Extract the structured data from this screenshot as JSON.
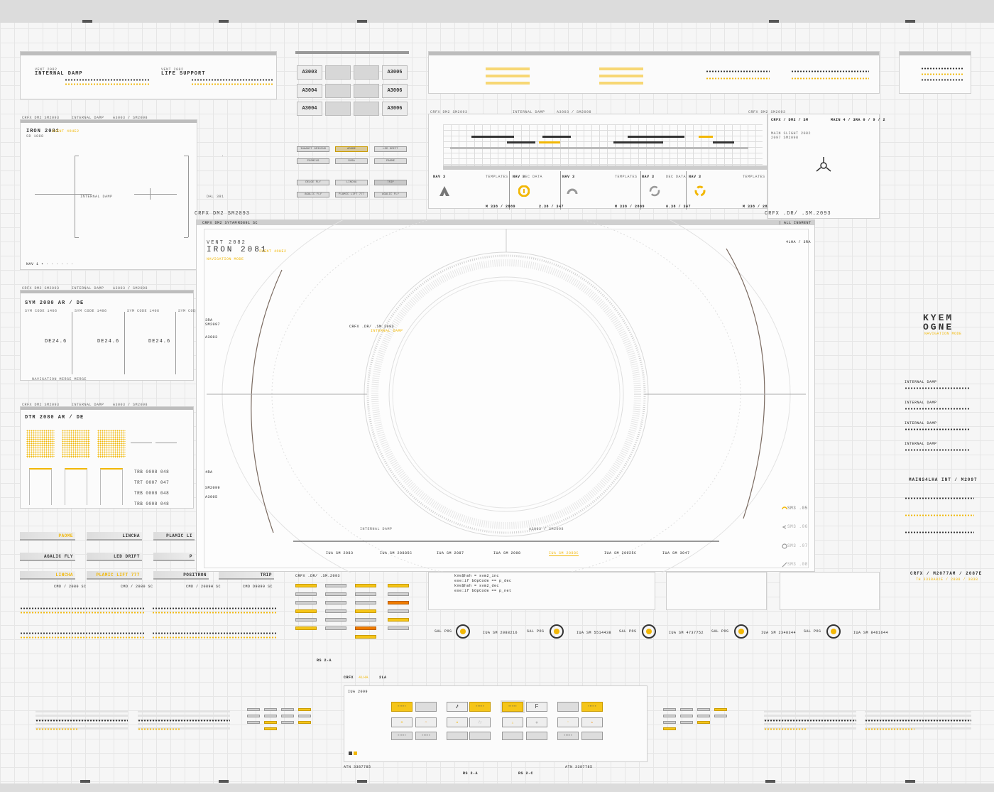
{
  "colors": {
    "accent": "#f2b705",
    "warn": "#f08a00",
    "ink": "#333333"
  },
  "top_panel": {
    "left_title_a_small": "VENT 2082",
    "left_title_a": "INTERNAL DAMP",
    "left_title_b_small": "VENT 2082",
    "left_title_b": "LIFE SUPPORT"
  },
  "tiles": [
    "A3003",
    "A3005",
    "A3004",
    "A3006",
    "A3004",
    "A3006"
  ],
  "tile_buttons": [
    "INHABIT ORIGINS",
    "ADOBE",
    "LED DRIFT",
    "POSMIUS",
    "SUSA",
    "PAOME",
    "DELGE FLY",
    "LINCHA",
    "TRIP",
    "AGALIC FLY",
    "PLAMIC LIFT 777",
    "AGALIC FLY"
  ],
  "left_iron_panel": {
    "header_a": "CRFX DM2 SM2093",
    "header_b": "INTERNAL DAMP",
    "header_c": "A3003 / SM2098",
    "title": "IRON 2081",
    "title_tag": "2VENT 4OHE2",
    "sub": "SD 1088",
    "label_mid": "INTERNAL DAMP",
    "label_right": "DAL 391"
  },
  "sym_panel": {
    "header_a": "CRFX DM2 SM2093",
    "header_b": "INTERNAL DAMP",
    "header_c": "A3003 / SM2098",
    "title": "SYM 2080 AR / DE",
    "cols": [
      "SYM CODE 1406",
      "SYM CODE 1406",
      "SYM CODE 1406",
      "SYM CODE 1406"
    ],
    "values": [
      "DE24.6",
      "DE24.6",
      "DE24.6"
    ],
    "foot": "NAVIGATION   MERGE   MERGE"
  },
  "dtr_panel": {
    "header_a": "CRFX DM2 SM2093",
    "header_b": "INTERNAL DAMP",
    "header_c": "A3003 / SM2098",
    "title": "DTR 2080 AR / DE",
    "rows": [
      "TRB  0008  048",
      "TRT  0007  047",
      "TRB  0008  048",
      "TRB  0008  048"
    ]
  },
  "side_buttons": [
    {
      "label": "PAOME",
      "accent": true
    },
    {
      "label": "LINCHA",
      "accent": false
    },
    {
      "label": "PLAMIC LI",
      "accent": false
    },
    {
      "label": "AGALIC FLY",
      "accent": false
    },
    {
      "label": "LED DRIFT",
      "accent": false
    },
    {
      "label": "P",
      "accent": false
    },
    {
      "label": "LINCHA",
      "accent": true
    },
    {
      "label": "PLAMIC LIFT 777",
      "accent": true
    },
    {
      "label": "POSITRON",
      "accent": false
    },
    {
      "label": "TRIP",
      "accent": false
    }
  ],
  "side_codes": [
    "CMD / 2080 SC",
    "CMD / 2080 SC",
    "CMD / 2089H SC",
    "CMD D9899 SC"
  ],
  "main": {
    "top_left_header": "CRFX DM2 SM2093",
    "top_right_header": "CRFX .DR/ .SM.2093",
    "sub_left": "CRFX DM2 SYTAM",
    "sub_left2": "RD891 SC",
    "alignment": "| ALL INGMENT",
    "vent": "VENT 2082",
    "iron": "IRON 2081",
    "iron_tag": "2VENT 4OHE2",
    "nav_status": "NAVIGATION MODE",
    "corner_tr": "4LHA / 3RA",
    "left_a": "3RA",
    "left_b": "SM2097",
    "left_c": "A3003",
    "left_d": "4RA",
    "left_e": "SM2099",
    "left_f": "A3005",
    "ring_label": "CRFX .DR/ .SM.2093",
    "ring_sub": "INTERNAL DAMP",
    "bottom_left": "INTERNAL DAMP",
    "bottom_right": "A3003 / SM2098",
    "scale_labels": [
      "IUA SM 2083",
      "IUA SM 20885C",
      "IUA SM 2087",
      "IUA SM 2098",
      "IUA SM 2088C",
      "IUA SM 20925C",
      "IUA SM 3047"
    ],
    "sm_labels": [
      "SM3 .05",
      "SM3 .06",
      "SM3 .07",
      "SM3 .08"
    ]
  },
  "schedule_panel": {
    "header_a": "CRFX DM2 SM2093",
    "header_b": "INTERNAL DAMP",
    "header_c": "A3003 / SM2098",
    "header_d": "CRFX DM2 SM2093",
    "cards": [
      {
        "tag": "NAV 3",
        "mode": "TEMPLATES",
        "value": "M 338 / 2889"
      },
      {
        "tag": "NAV 3",
        "mode": "DEC DATA",
        "value": "2.38 / 347"
      },
      {
        "tag": "NAV 3",
        "mode": "TEMPLATES",
        "value": "M 338 / 2889"
      },
      {
        "tag": "NAV 3",
        "mode": "DEC DATA",
        "value": "0.38 / 347"
      },
      {
        "tag": "NAV 3",
        "mode": "TEMPLATES",
        "value": "M 338 / 2889"
      }
    ]
  },
  "right_panel": {
    "title": "CRFX / DM2 / SM",
    "sub": "MAIN 4 / 3RA 0 / 9 / 2",
    "text_a": "MAIN SLIGHT 2082",
    "text_b": "2097 SM2098",
    "brand_top": "KYEM",
    "brand_bottom": "OGNE",
    "brand_sub": "NAVIGATION MODE",
    "internal_labels": [
      "INTERNAL DAMP",
      "INTERNAL DAMP",
      "INTERNAL DAMP",
      "INTERNAL DAMP"
    ],
    "mains_title": "MAINS4LHA INT / M2097",
    "crfx_title": "CRFX / M2077AM / 2087E",
    "crfx_sub": "TH 3338A92E / 2808 / 3838"
  },
  "code_panel": {
    "lines": [
      "kVe$hsh = svm2_inc",
      "exe:if bOpCode == p_dec",
      "kVe$hsh = svm2_dec",
      "exe:if bOpCode == p_net"
    ]
  },
  "dial_row": {
    "labels": [
      "SAL POS",
      "SAL POS",
      "SAL POS",
      "SAL POS",
      "SAL POS"
    ],
    "codes": [
      "IUA SM 2088216",
      "IUA SM 5514438",
      "IUA SM 4737752",
      "IUA SM 2348344",
      "IUA SM 8461644"
    ]
  },
  "bottom": {
    "ctrl_header_a": "CRFX",
    "ctrl_header_b": "4LHA",
    "ctrl_header_c": "2LA",
    "ctrl_code": "IUA 2099",
    "foot_a": "ATN 3387785",
    "foot_b": "ATN 3387785",
    "foot_c": "RS 2-A",
    "foot_d": "RS 2-C",
    "foot_e": "RS 2-A"
  }
}
